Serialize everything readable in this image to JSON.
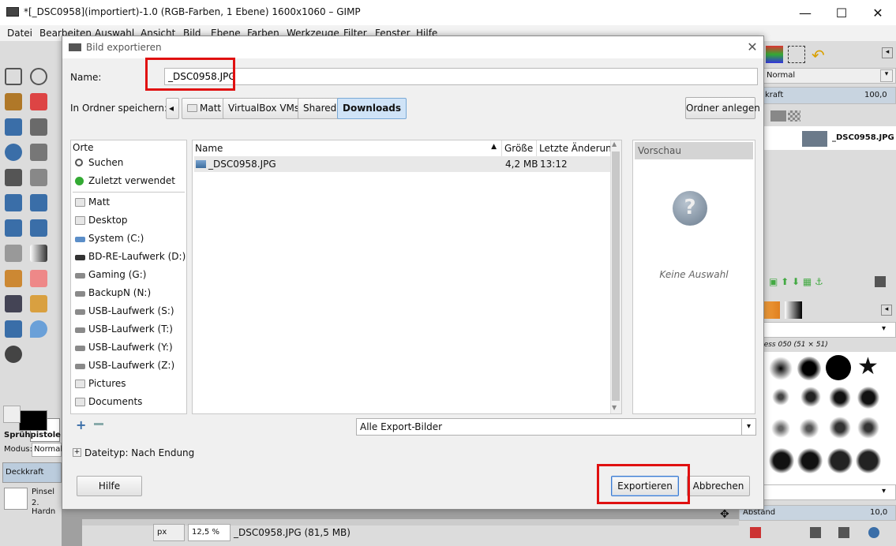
{
  "gimp": {
    "title": "*[_DSC0958](importiert)-1.0 (RGB-Farben, 1 Ebene) 1600x1060 – GIMP",
    "window_controls": [
      "—",
      "☐",
      "✕"
    ],
    "menu": [
      "Datei",
      "Bearbeiten",
      "Auswahl",
      "Ansicht",
      "Bild",
      "Ebene",
      "Farben",
      "Werkzeuge",
      "Filter",
      "Fenster",
      "Hilfe"
    ],
    "tool_options": {
      "title": "Sprühpistole",
      "mode_label": "Modus:",
      "mode_value": "Normal",
      "opacity_label": "Deckkraft",
      "brush_label": "Pinsel",
      "brush_value": "2. Hardn"
    },
    "right_panel": {
      "mode_label": "Normal",
      "opacity_label": "kraft",
      "opacity_value": "100,0",
      "layer_name": "_DSC0958.JPG",
      "brush_name": "ness 050 (51 × 51)",
      "spacing_label": "Abstand",
      "spacing_value": "10,0"
    },
    "status": {
      "unit": "px",
      "zoom": "12,5 %",
      "info": "_DSC0958.JPG (81,5 MB)"
    }
  },
  "dialog": {
    "title": "Bild exportieren",
    "name_label": "Name:",
    "name_value": "_DSC0958.JPG",
    "folder_label": "In Ordner speichern:",
    "breadcrumbs": [
      "Matt",
      "VirtualBox VMs",
      "Shared",
      "Downloads"
    ],
    "active_crumb": "Downloads",
    "create_folder": "Ordner anlegen",
    "places_header": "Orte",
    "places": [
      {
        "label": "Suchen",
        "icon": "search-icon"
      },
      {
        "label": "Zuletzt verwendet",
        "icon": "recent-icon"
      },
      {
        "label": "Matt",
        "icon": "folder-icon"
      },
      {
        "label": "Desktop",
        "icon": "folder-icon"
      },
      {
        "label": "System (C:)",
        "icon": "drive-icon"
      },
      {
        "label": "BD-RE-Laufwerk (D:)",
        "icon": "disc-drive-icon"
      },
      {
        "label": "Gaming (G:)",
        "icon": "drive-icon"
      },
      {
        "label": "BackupN (N:)",
        "icon": "drive-icon"
      },
      {
        "label": "USB-Laufwerk (S:)",
        "icon": "drive-icon"
      },
      {
        "label": "USB-Laufwerk (T:)",
        "icon": "drive-icon"
      },
      {
        "label": "USB-Laufwerk (Y:)",
        "icon": "drive-icon"
      },
      {
        "label": "USB-Laufwerk (Z:)",
        "icon": "drive-icon"
      },
      {
        "label": "Pictures",
        "icon": "folder-icon"
      },
      {
        "label": "Documents",
        "icon": "folder-icon"
      }
    ],
    "columns": {
      "name": "Name",
      "size": "Größe",
      "modified": "Letzte Änderung"
    },
    "files": [
      {
        "name": "_DSC0958.JPG",
        "size": "4,2 MB",
        "modified": "13:12"
      }
    ],
    "preview_header": "Vorschau",
    "preview_empty": "Keine Auswahl",
    "filter_value": "Alle Export-Bilder",
    "filetype_label": "Dateityp: Nach Endung",
    "help_button": "Hilfe",
    "export_button": "Exportieren",
    "cancel_button": "Abbrechen"
  },
  "colors": {
    "highlight": "#e01010",
    "active_crumb": "#cfe3f7"
  }
}
